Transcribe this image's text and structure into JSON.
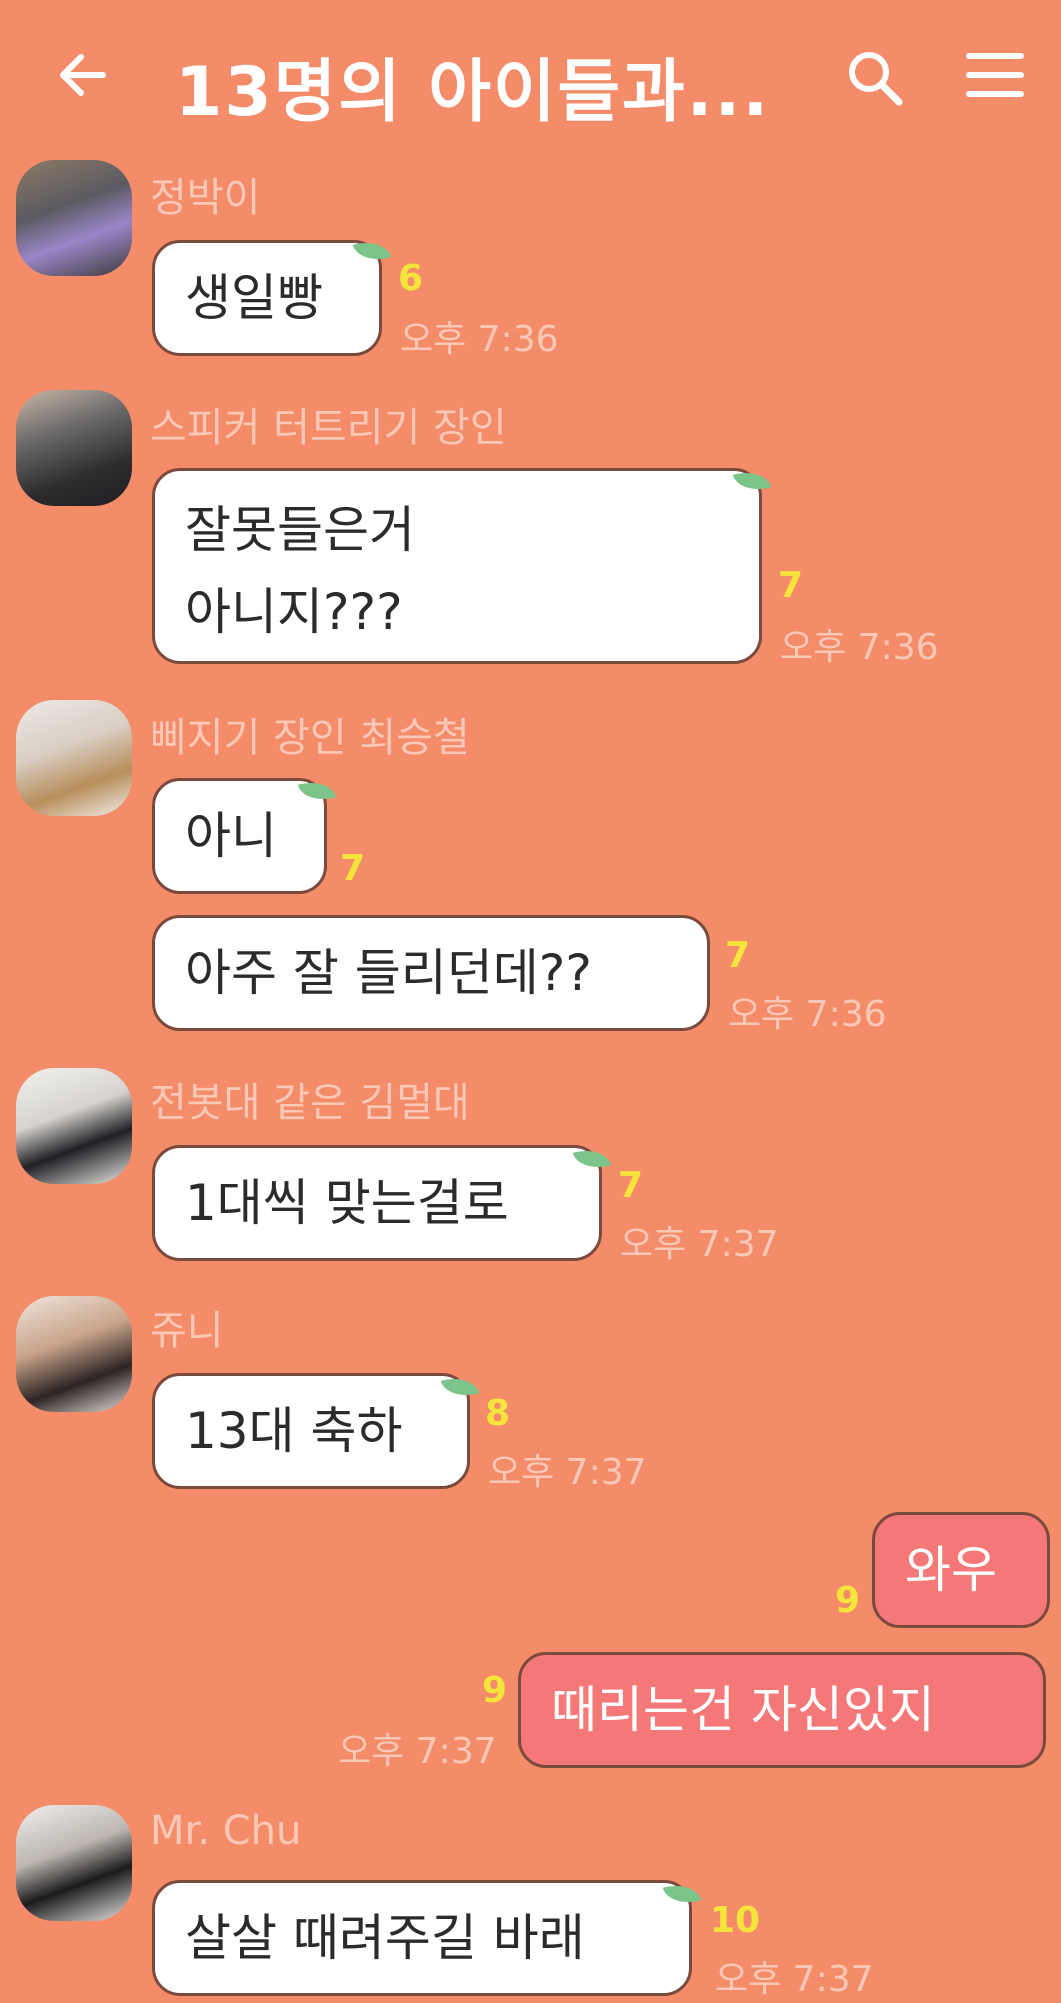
{
  "header": {
    "title": "13명의 아이들과...",
    "back_icon": "arrow-left-icon",
    "search_icon": "search-icon",
    "menu_icon": "hamburger-menu-icon"
  },
  "colors": {
    "background": "#F48C6A",
    "bubble_incoming": "#FFFFFF",
    "bubble_outgoing": "#F47878",
    "unread_count": "#F5E43A",
    "meta_text": "#F9C8B6"
  },
  "messages": [
    {
      "sender": "정박이",
      "text": "생일빵",
      "unread": "6",
      "time": "오후 7:36"
    },
    {
      "sender": "스피커 터트리기 장인",
      "lines": [
        "잘못들은거",
        "아니지???"
      ],
      "unread": "7",
      "time": "오후 7:36"
    },
    {
      "sender": "삐지기 장인 최승철",
      "text": "아니",
      "unread": "7"
    },
    {
      "text": "아주 잘 들리던데??",
      "unread": "7",
      "time": "오후 7:36"
    },
    {
      "sender": "전봇대 같은 김멀대",
      "text": "1대씩 맞는걸로",
      "unread": "7",
      "time": "오후 7:37"
    },
    {
      "sender": "쥬니",
      "text": "13대 축하",
      "unread": "8",
      "time": "오후 7:37"
    },
    {
      "text": "와우",
      "unread": "9",
      "mine": true
    },
    {
      "text": "때리는건 자신있지",
      "unread": "9",
      "time": "오후 7:37",
      "mine": true
    },
    {
      "sender": "Mr. Chu",
      "text": "살살 때려주길 바래",
      "unread": "10",
      "time": "오후 7:37"
    }
  ]
}
